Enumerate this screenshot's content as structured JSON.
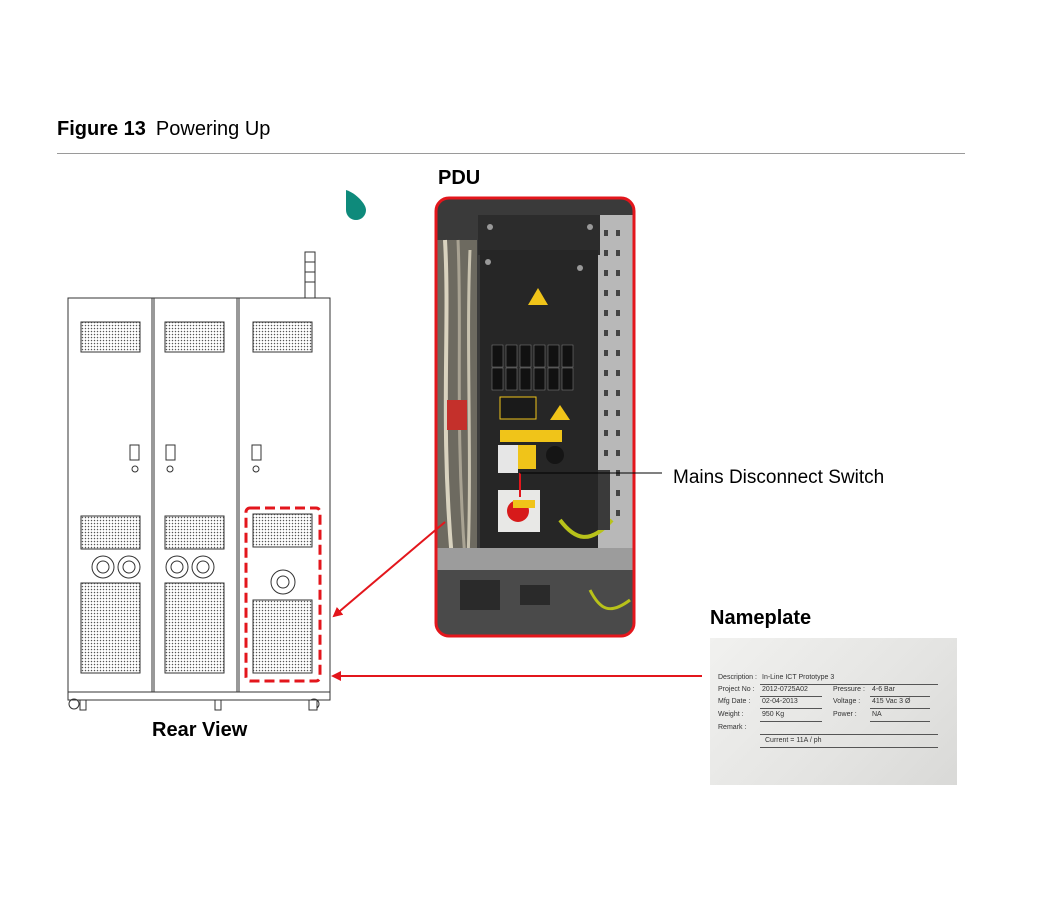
{
  "figure": {
    "number": "Figure 13",
    "title": "Powering Up"
  },
  "labels": {
    "pdu": "PDU",
    "mains_switch": "Mains Disconnect Switch",
    "nameplate": "Nameplate",
    "rear_view": "Rear View"
  },
  "nameplate": {
    "description_label": "Description :",
    "description_value": "In-Line ICT Prototype 3",
    "project_label": "Project No :",
    "project_value": "2012-0725A02",
    "pressure_label": "Pressure :",
    "pressure_value": "4-6 Bar",
    "mfg_label": "Mfg Date :",
    "mfg_value": "02-04-2013",
    "voltage_label": "Voltage :",
    "voltage_value": "415 Vac 3 Ø",
    "weight_label": "Weight :",
    "weight_value": "950 Kg",
    "power_label": "Power :",
    "power_value": "NA",
    "remark_label": "Remark :",
    "current_value": "Current = 11A / ph"
  },
  "colors": {
    "callout_red": "#e3161c",
    "marker_teal": "#0e8a7b"
  }
}
